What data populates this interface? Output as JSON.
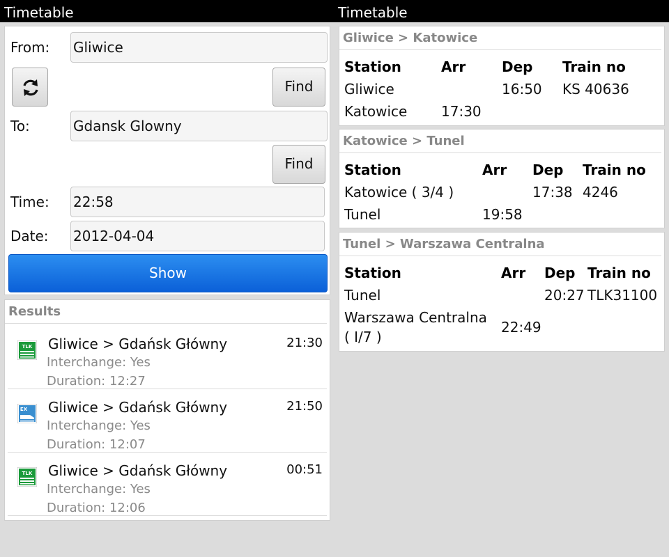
{
  "header": {
    "left_title": "Timetable",
    "right_title": "Timetable"
  },
  "form": {
    "from_label": "From:",
    "from_value": "Gliwice",
    "find_label": "Find",
    "to_label": "To:",
    "to_value": "Gdansk Glowny",
    "find2_label": "Find",
    "time_label": "Time:",
    "time_value": "22:58",
    "date_label": "Date:",
    "date_value": "2012-04-04",
    "show_label": "Show",
    "swap_icon": "refresh-icon"
  },
  "results": {
    "title": "Results",
    "items": [
      {
        "route": "Gliwice > Gdańsk Główny",
        "time": "21:30",
        "interchange": "Interchange: Yes",
        "duration": "Duration: 12:27",
        "icon": "tlk-train-icon",
        "icon_color": "#1a9a3a"
      },
      {
        "route": "Gliwice > Gdańsk Główny",
        "time": "21:50",
        "interchange": "Interchange: Yes",
        "duration": "Duration: 12:07",
        "icon": "ex-train-icon",
        "icon_color": "#3a8fd0"
      },
      {
        "route": "Gliwice > Gdańsk Główny",
        "time": "00:51",
        "interchange": "Interchange: Yes",
        "duration": "Duration: 12:06",
        "icon": "tlk-train-icon",
        "icon_color": "#1a9a3a"
      }
    ]
  },
  "segments": [
    {
      "title": "Gliwice > Katowice",
      "headers": {
        "station": "Station",
        "arr": "Arr",
        "dep": "Dep",
        "train": "Train no"
      },
      "rows": [
        {
          "station": "Gliwice",
          "arr": "",
          "dep": "16:50",
          "train": "KS 40636"
        },
        {
          "station": "Katowice",
          "arr": "17:30",
          "dep": "",
          "train": ""
        }
      ]
    },
    {
      "title": "Katowice > Tunel",
      "headers": {
        "station": "Station",
        "arr": "Arr",
        "dep": "Dep",
        "train": "Train no"
      },
      "rows": [
        {
          "station": "Katowice ( 3/4 )",
          "arr": "",
          "dep": "17:38",
          "train": "4246"
        },
        {
          "station": "Tunel",
          "arr": "19:58",
          "dep": "",
          "train": ""
        }
      ]
    },
    {
      "title": "Tunel > Warszawa Centralna",
      "headers": {
        "station": "Station",
        "arr": "Arr",
        "dep": "Dep",
        "train": "Train no"
      },
      "rows": [
        {
          "station": "Tunel",
          "arr": "",
          "dep": "20:27",
          "train": "TLK31100"
        },
        {
          "station": "Warszawa Centralna",
          "station2": "( I/7 )",
          "arr": "22:49",
          "dep": "",
          "train": ""
        }
      ]
    }
  ]
}
